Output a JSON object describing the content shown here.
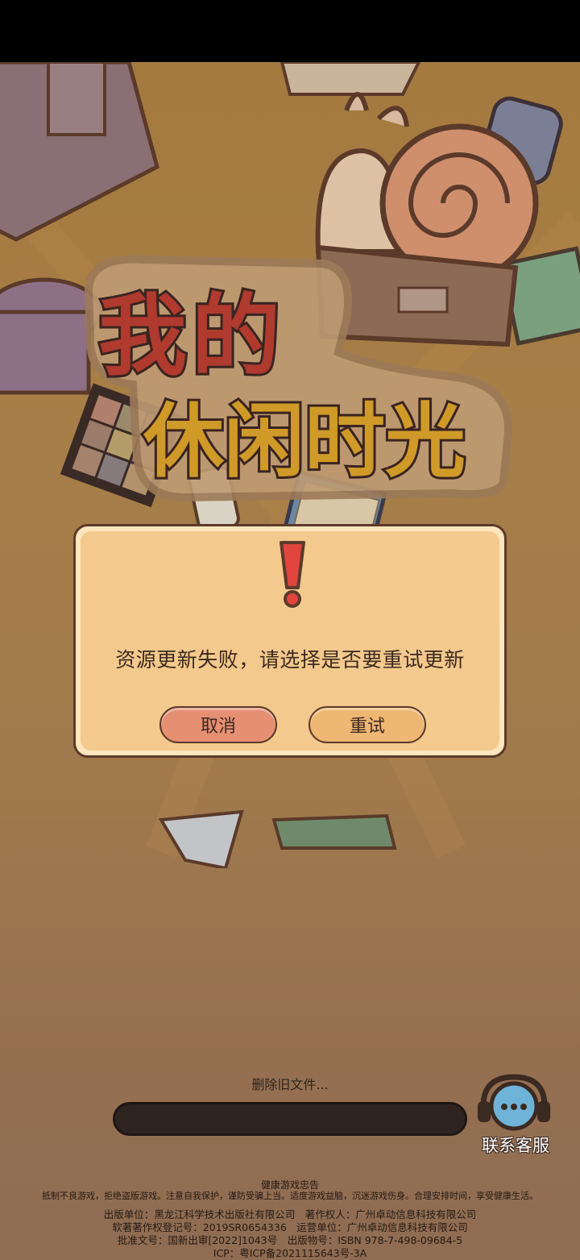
{
  "game": {
    "title_line1": "我的",
    "title_line2": "休闲时光"
  },
  "dialog": {
    "message": "资源更新失败，请选择是否要重试更新",
    "cancel_label": "取消",
    "retry_label": "重试"
  },
  "loading": {
    "status": "删除旧文件...",
    "progress": 0
  },
  "support": {
    "label": "联系客服",
    "icon": "customer-service-headset-icon"
  },
  "footer": {
    "title": "健康游戏忠告",
    "advice": "抵制不良游戏，拒绝盗版游戏。注意自我保护，谨防受骗上当。适度游戏益脑，沉迷游戏伤身。合理安排时间，享受健康生活。",
    "line1": "出版单位：黑龙江科学技术出版社有限公司　著作权人：广州卓动信息科技有限公司",
    "line2": "软著著作权登记号：2019SR0654336　运营单位：广州卓动信息科技有限公司",
    "line3": "批准文号：国新出审[2022]1043号　出版物号：ISBN 978-7-498-09684-5",
    "line4": "ICP：粤ICP备2021115643号-3A"
  },
  "colors": {
    "background": "#a57a3f",
    "dialog_fill": "#f3c98d",
    "dialog_border": "#5b3a2a",
    "cancel_button": "#e58f73",
    "retry_button": "#eeb773",
    "progress_track": "#2e231f"
  }
}
